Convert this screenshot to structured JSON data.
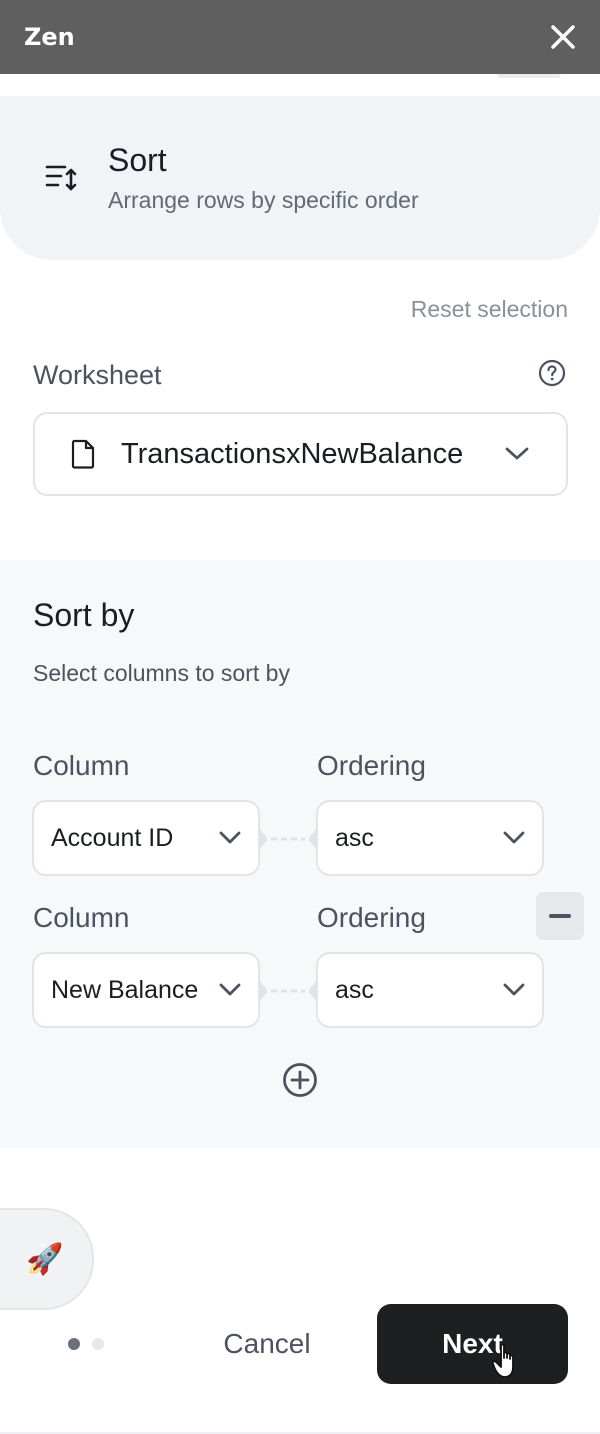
{
  "window": {
    "title": "Zen",
    "close_icon": "close-icon"
  },
  "header": {
    "icon": "sort-icon",
    "title": "Sort",
    "subtitle": "Arrange rows by specific order"
  },
  "reset_label": "Reset selection",
  "worksheet": {
    "label": "Worksheet",
    "help_icon": "help-icon",
    "file_icon": "file-icon",
    "value": "TransactionsxNewBalance"
  },
  "sort_by": {
    "title": "Sort by",
    "subtitle": "Select columns to sort by",
    "rows": [
      {
        "column_label": "Column",
        "column_value": "Account ID",
        "ordering_label": "Ordering",
        "ordering_value": "asc"
      },
      {
        "column_label": "Column",
        "column_value": "New Balance",
        "ordering_label": "Ordering",
        "ordering_value": "asc"
      }
    ],
    "add_icon": "add-circle-icon",
    "remove_icon": "minus-icon"
  },
  "footer": {
    "rocket_icon": "🚀",
    "cancel_label": "Cancel",
    "next_label": "Next",
    "steps_total": 2,
    "steps_current": 1
  },
  "colors": {
    "titlebar": "#5f5f5f",
    "header_bg": "#f1f3f7",
    "panel_bg": "#f7f8fa",
    "primary_button": "#1e1f21",
    "muted_text": "#8a9099"
  }
}
